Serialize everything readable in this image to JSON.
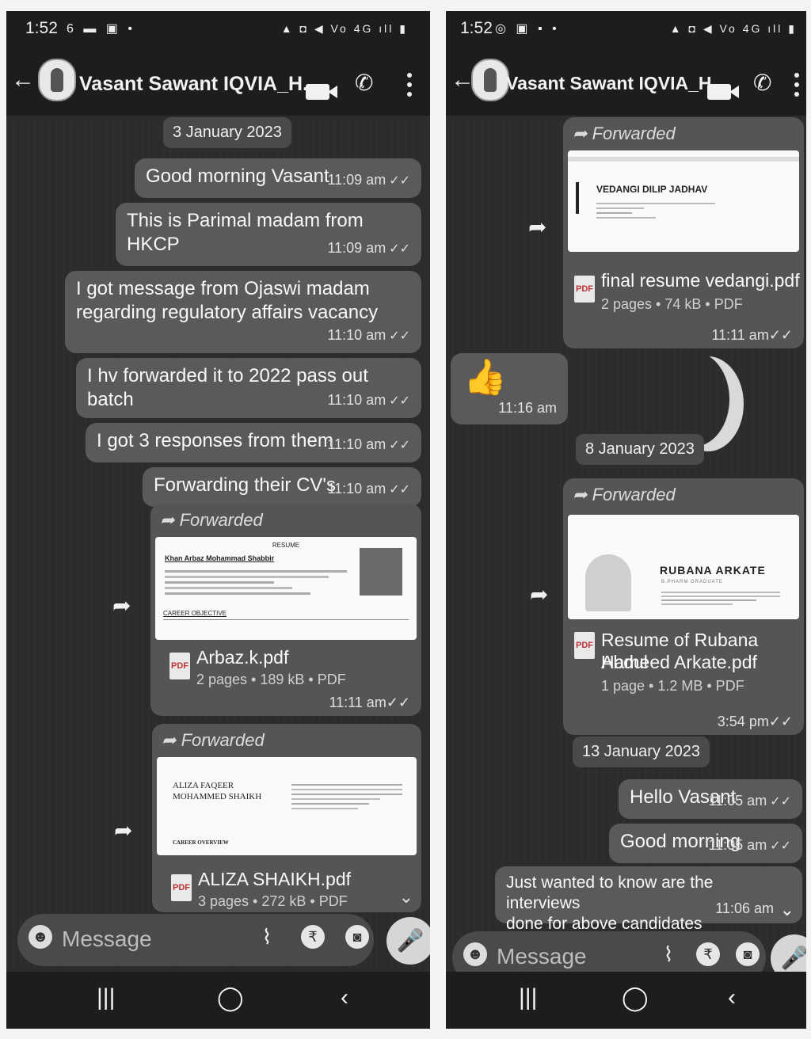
{
  "left": {
    "status_time": "1:52",
    "status_left_icons": "6 ▬ ▣ •",
    "status_right_icons": "▲ ◘ ◀ Vo 4G ıll ▮",
    "contact_name": "Vasant Sawant IQVIA_H...",
    "date_divider": "3 January 2023",
    "messages": [
      {
        "text": "Good morning Vasant",
        "time": "11:09 am"
      },
      {
        "text": "This is Parimal madam from HKCP",
        "time": "11:09 am"
      },
      {
        "line1": "I got message from Ojaswi madam",
        "line2": "regarding regulatory affairs vacancy",
        "time": "11:10 am"
      },
      {
        "text": "I hv forwarded it to 2022 pass out batch",
        "time": "11:10 am"
      },
      {
        "text": "I got 3 responses from them",
        "time": "11:10 am"
      },
      {
        "text": "Forwarding their CV's",
        "time": "11:10 am"
      }
    ],
    "files": [
      {
        "forwarded_label": "Forwarded",
        "preview_heading": "RESUME",
        "preview_name": "Khan Arbaz Mohammad Shabbir",
        "preview_section": "CAREER OBJECTIVE",
        "file_name": "Arbaz.k.pdf",
        "meta": "2 pages • 189 kB • PDF",
        "time": "11:11 am"
      },
      {
        "forwarded_label": "Forwarded",
        "preview_name_1": "ALIZA FAQEER",
        "preview_name_2": "MOHAMMED SHAIKH",
        "preview_section": "CAREER OVERVIEW",
        "file_name": "ALIZA SHAIKH.pdf",
        "meta": "3 pages • 272 kB • PDF"
      }
    ],
    "input_placeholder": "Message"
  },
  "right": {
    "status_time": "1:52",
    "status_left_icons": "◎ ▣ ▪ •",
    "status_right_icons": "▲ ◘ ◀ Vo 4G ıll ▮",
    "contact_name": "Vasant Sawant IQVIA_H...",
    "file1": {
      "forwarded_label": "Forwarded",
      "preview_name": "VEDANGI DILIP JADHAV",
      "file_name": "final resume vedangi.pdf",
      "meta": "2 pages • 74 kB • PDF",
      "time": "11:11 am"
    },
    "thumb_time": "11:16 am",
    "date_divider_1": "8 January 2023",
    "file2": {
      "forwarded_label": "Forwarded",
      "preview_name": "RUBANA ARKATE",
      "preview_sub": "B.PHARM GRADUATE",
      "file_name_1": "Resume of Rubana Abdul",
      "file_name_2": "Hameed Arkate.pdf",
      "meta": "1 page • 1.2 MB • PDF",
      "time": "3:54 pm"
    },
    "date_divider_2": "13 January 2023",
    "messages": [
      {
        "text": "Hello Vasant",
        "time": "11:05 am"
      },
      {
        "text": "Good morning",
        "time": "11:05 am"
      },
      {
        "line1": "Just wanted to know are the interviews",
        "line2": "done for above candidates",
        "time": "11:06 am"
      }
    ],
    "input_placeholder": "Message"
  },
  "icons": {
    "back": "arrow-left-icon",
    "video": "video-camera-icon",
    "phone": "phone-icon",
    "menu": "more-vert-icon",
    "share": "share-icon",
    "emoji": "emoji-icon",
    "attach": "paperclip-icon",
    "rupee": "rupee-icon",
    "camera": "camera-icon",
    "mic": "mic-icon",
    "scroll": "double-chevron-down-icon"
  },
  "glyphs": {
    "back": "←",
    "phone": "✆",
    "share": "➦",
    "emoji": "☻",
    "attach": "⌇",
    "rupee": "₹",
    "camera": "◙",
    "mic": "🎤",
    "thumb": "👍",
    "ticks": "✓✓",
    "scroll": "⌄",
    "nav_recent": "|||",
    "nav_home": "◯",
    "nav_back": "‹",
    "pdf": "PDF",
    "forward_arrow": "➦"
  }
}
